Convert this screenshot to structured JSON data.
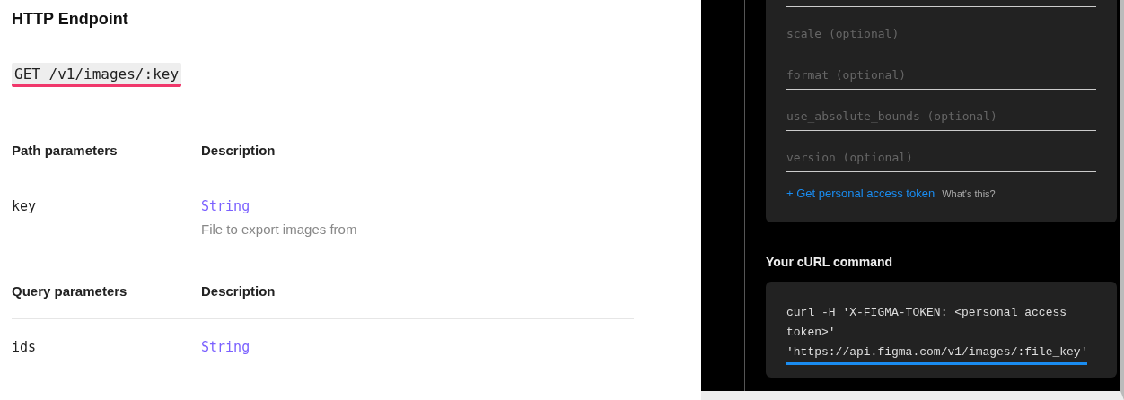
{
  "endpoint": {
    "title": "HTTP Endpoint",
    "request": "GET /v1/images/:key"
  },
  "parameter_tables": [
    {
      "header": [
        "Path parameters",
        "Description"
      ],
      "rows": [
        {
          "name": "key",
          "type": "String",
          "description": "File to export images from"
        }
      ]
    },
    {
      "header": [
        "Query parameters",
        "Description"
      ],
      "rows": [
        {
          "name": "ids",
          "type": "String"
        }
      ]
    }
  ],
  "try_panel": {
    "fields": [
      {
        "placeholder": "scale (optional)"
      },
      {
        "placeholder": "format (optional)"
      },
      {
        "placeholder": "use_absolute_bounds (optional)"
      },
      {
        "placeholder": "version (optional)"
      }
    ],
    "token_link": "+ Get personal access token",
    "help_link": "What's this?",
    "curl_title": "Your cURL command",
    "curl_command": "curl -H 'X-FIGMA-TOKEN: <personal access token>'",
    "curl_url": "'https://api.figma.com/v1/images/:file_key'"
  }
}
